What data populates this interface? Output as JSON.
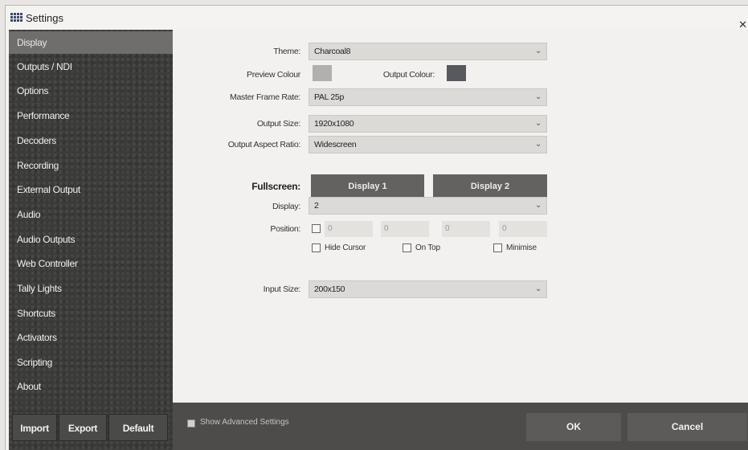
{
  "window": {
    "title": "Settings"
  },
  "sidebar": {
    "items": [
      {
        "label": "Display",
        "active": true
      },
      {
        "label": "Outputs / NDI"
      },
      {
        "label": "Options"
      },
      {
        "label": "Performance"
      },
      {
        "label": "Decoders"
      },
      {
        "label": "Recording"
      },
      {
        "label": "External Output"
      },
      {
        "label": "Audio"
      },
      {
        "label": "Audio Outputs"
      },
      {
        "label": "Web Controller"
      },
      {
        "label": "Tally Lights"
      },
      {
        "label": "Shortcuts"
      },
      {
        "label": "Activators"
      },
      {
        "label": "Scripting"
      },
      {
        "label": "About"
      }
    ],
    "buttons": {
      "import": "Import",
      "export": "Export",
      "default": "Default"
    }
  },
  "display": {
    "theme": {
      "label": "Theme:",
      "value": "Charcoal8"
    },
    "preview_colour": {
      "label": "Preview Colour",
      "color": "#b2b0ad"
    },
    "output_colour": {
      "label": "Output Colour:",
      "color": "#565a5e"
    },
    "master_frame_rate": {
      "label": "Master Frame Rate:",
      "value": "PAL 25p"
    },
    "output_size": {
      "label": "Output Size:",
      "value": "1920x1080"
    },
    "output_aspect_ratio": {
      "label": "Output Aspect Ratio:",
      "value": "Widescreen"
    },
    "fullscreen": {
      "label": "Fullscreen:",
      "display1": "Display 1",
      "display2": "Display 2"
    },
    "display": {
      "label": "Display:",
      "value": "2"
    },
    "position": {
      "label": "Position:",
      "values": [
        "0",
        "0",
        "0",
        "0"
      ]
    },
    "hide_cursor": {
      "label": "Hide Cursor",
      "checked": false
    },
    "on_top": {
      "label": "On Top",
      "checked": false
    },
    "minimise": {
      "label": "Minimise",
      "checked": false
    },
    "input_size": {
      "label": "Input Size:",
      "value": "200x150"
    }
  },
  "footer": {
    "show_advanced_label": "Show Advanced Settings",
    "ok": "OK",
    "cancel": "Cancel"
  },
  "icons": {
    "chevron": "chevron-down-icon",
    "close": "close-icon",
    "app": "grid-app-icon"
  }
}
